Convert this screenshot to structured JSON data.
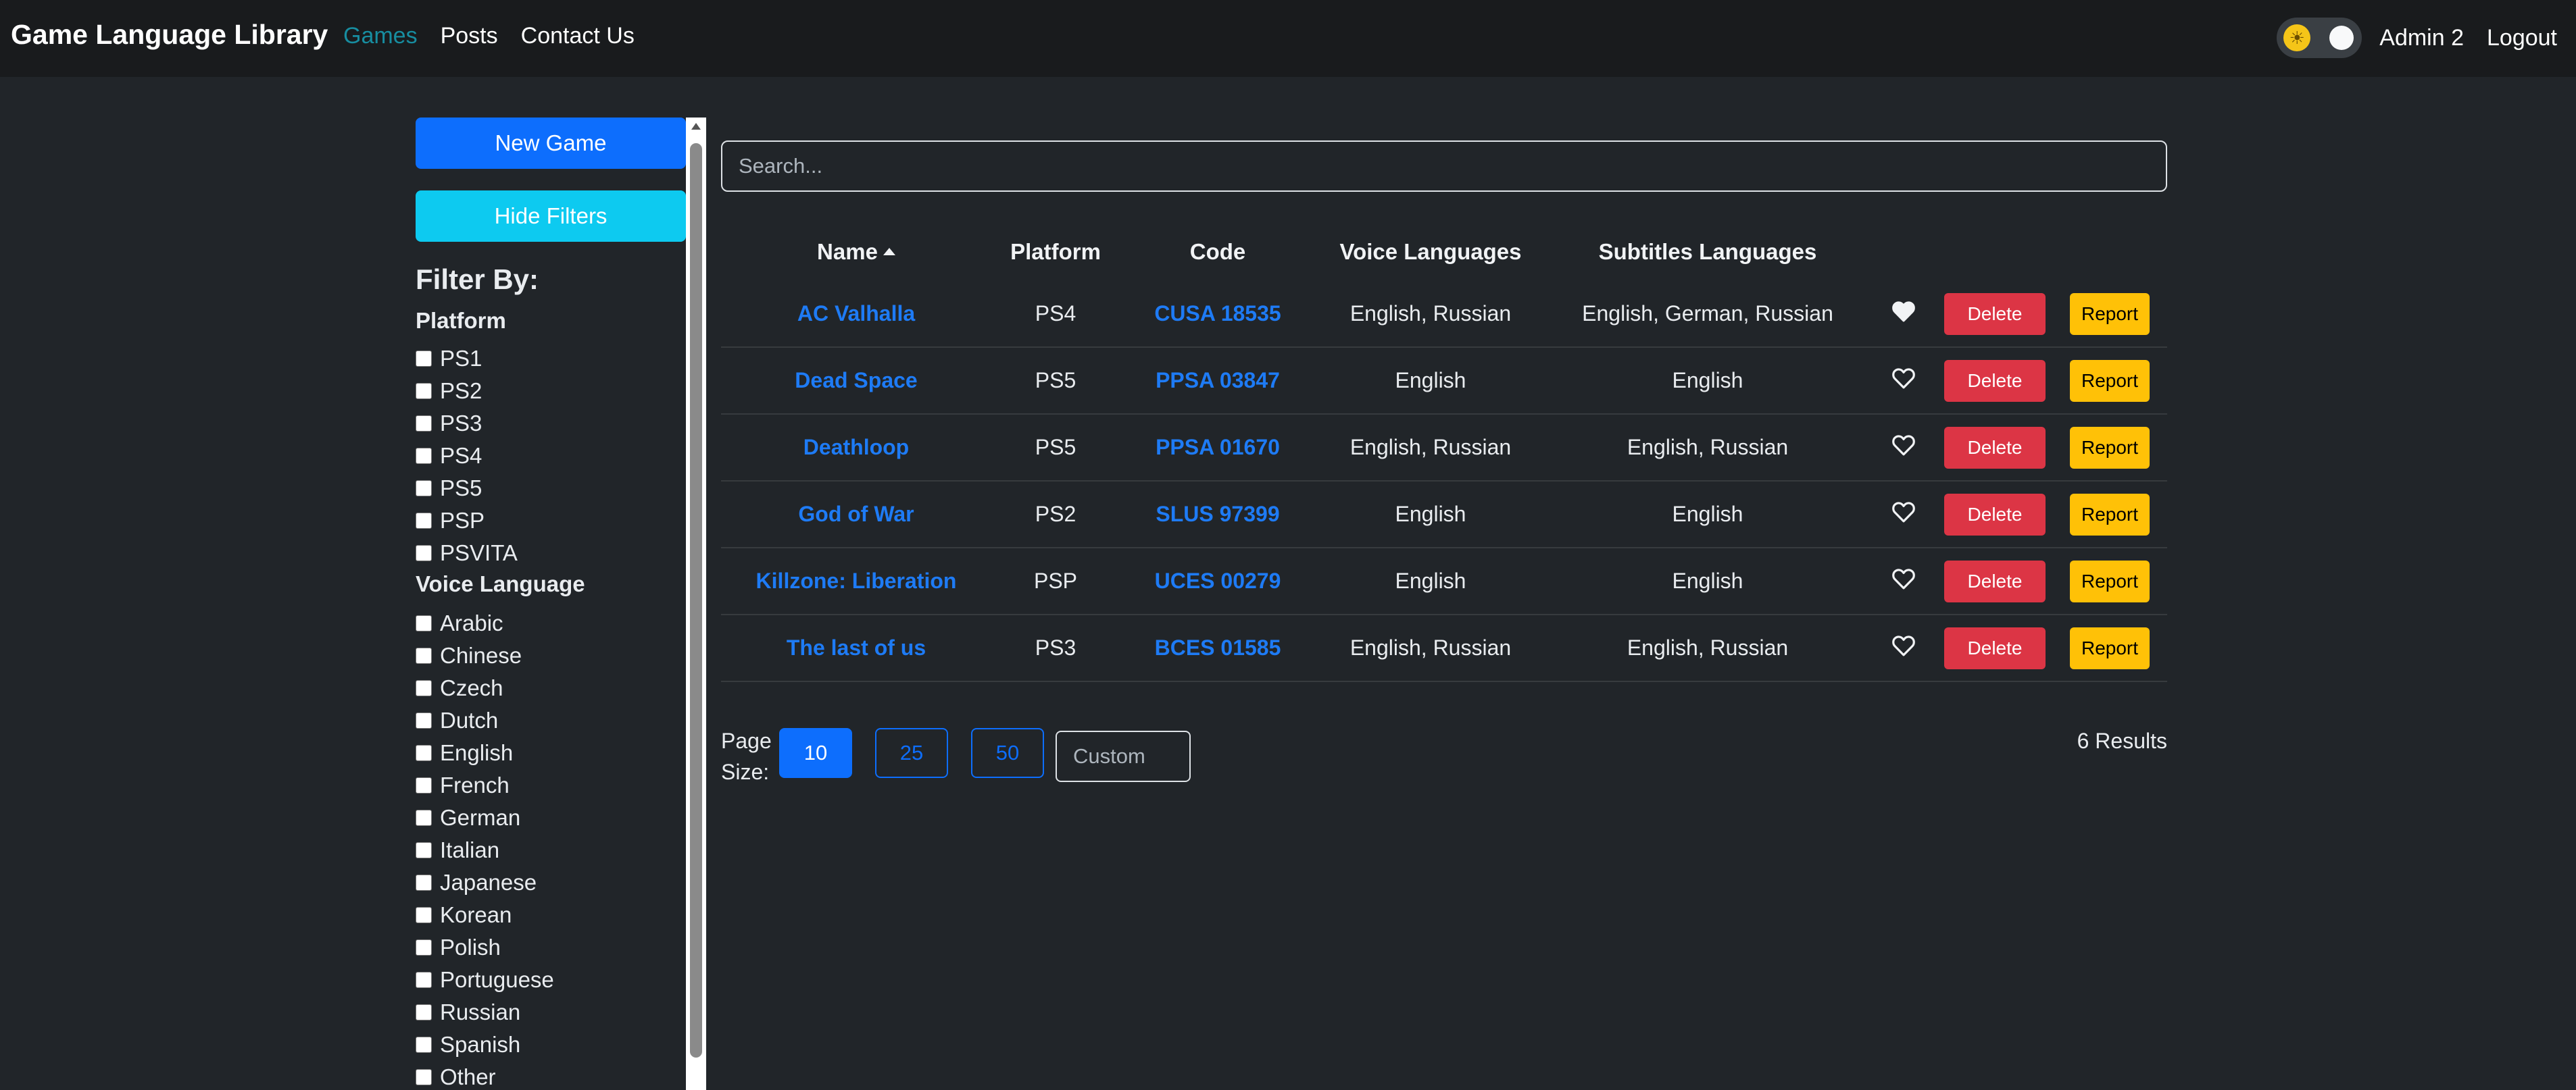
{
  "navbar": {
    "brand": "Game Language Library",
    "links": [
      "Games",
      "Posts",
      "Contact Us"
    ],
    "user": "Admin 2",
    "logout": "Logout",
    "theme_icon": "sun-icon"
  },
  "sidebar": {
    "new_game": "New Game",
    "hide_filters": "Hide Filters",
    "filter_by": "Filter By:",
    "platform_title": "Platform",
    "platforms": [
      "PS1",
      "PS2",
      "PS3",
      "PS4",
      "PS5",
      "PSP",
      "PSVITA"
    ],
    "voice_title": "Voice Language",
    "voice_languages": [
      "Arabic",
      "Chinese",
      "Czech",
      "Dutch",
      "English",
      "French",
      "German",
      "Italian",
      "Japanese",
      "Korean",
      "Polish",
      "Portuguese",
      "Russian",
      "Spanish",
      "Other"
    ]
  },
  "search": {
    "placeholder": "Search..."
  },
  "table": {
    "headers": [
      "Name",
      "Platform",
      "Code",
      "Voice Languages",
      "Subtitles Languages"
    ],
    "delete_label": "Delete",
    "report_label": "Report",
    "rows": [
      {
        "name": "AC Valhalla",
        "platform": "PS4",
        "code": "CUSA 18535",
        "voice": "English, Russian",
        "subs": "English, German, Russian",
        "favorite": true
      },
      {
        "name": "Dead Space",
        "platform": "PS5",
        "code": "PPSA 03847",
        "voice": "English",
        "subs": "English",
        "favorite": false
      },
      {
        "name": "Deathloop",
        "platform": "PS5",
        "code": "PPSA 01670",
        "voice": "English, Russian",
        "subs": "English, Russian",
        "favorite": false
      },
      {
        "name": "God of War",
        "platform": "PS2",
        "code": "SLUS 97399",
        "voice": "English",
        "subs": "English",
        "favorite": false
      },
      {
        "name": "Killzone: Liberation",
        "platform": "PSP",
        "code": "UCES 00279",
        "voice": "English",
        "subs": "English",
        "favorite": false
      },
      {
        "name": "The last of us",
        "platform": "PS3",
        "code": "BCES 01585",
        "voice": "English, Russian",
        "subs": "English, Russian",
        "favorite": false
      }
    ]
  },
  "pager": {
    "label_line1": "Page",
    "label_line2": "Size:",
    "sizes": [
      "10",
      "25",
      "50"
    ],
    "custom_placeholder": "Custom",
    "results": "6 Results"
  },
  "colors": {
    "background": "#212529",
    "navbar": "#191b1d",
    "primary": "#0d6efd",
    "info": "#0dcaf0",
    "danger": "#dc3545",
    "warning": "#ffc107"
  }
}
